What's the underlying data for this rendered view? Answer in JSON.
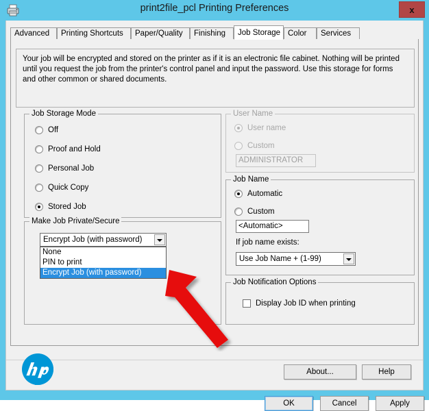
{
  "window": {
    "title": "print2file_pcl Printing Preferences",
    "icon": "printer-icon",
    "close_label": "x",
    "titlebar_color": "#5ec7e8",
    "close_color": "#b14646"
  },
  "tabs": [
    {
      "label": "Advanced",
      "selected": false
    },
    {
      "label": "Printing Shortcuts",
      "selected": false
    },
    {
      "label": "Paper/Quality",
      "selected": false
    },
    {
      "label": "Finishing",
      "selected": false
    },
    {
      "label": "Job Storage",
      "selected": true
    },
    {
      "label": "Color",
      "selected": false
    },
    {
      "label": "Services",
      "selected": false
    }
  ],
  "description": "Your job will be encrypted and stored on the printer as if it is an electronic file cabinet.  Nothing will be printed until you request the job from the printer's control panel and input the password.  Use this storage for forms and other common or shared documents.",
  "job_storage_mode": {
    "legend": "Job Storage Mode",
    "options": [
      {
        "label": "Off",
        "checked": false
      },
      {
        "label": "Proof and Hold",
        "checked": false
      },
      {
        "label": "Personal Job",
        "checked": false
      },
      {
        "label": "Quick Copy",
        "checked": false
      },
      {
        "label": "Stored Job",
        "checked": true
      }
    ]
  },
  "make_private": {
    "legend": "Make Job Private/Secure",
    "selected_value": "Encrypt Job (with password)",
    "expanded": true,
    "options": [
      {
        "label": "None",
        "selected": false
      },
      {
        "label": "PIN to print",
        "selected": false
      },
      {
        "label": "Encrypt Job (with password)",
        "selected": true
      }
    ],
    "highlight_color": "#2b8fe0"
  },
  "user_name": {
    "legend": "User Name",
    "disabled": true,
    "options": [
      {
        "label": "User name",
        "checked": true
      },
      {
        "label": "Custom",
        "checked": false
      }
    ],
    "custom_value": "ADMINISTRATOR"
  },
  "job_name": {
    "legend": "Job Name",
    "options": [
      {
        "label": "Automatic",
        "checked": true
      },
      {
        "label": "Custom",
        "checked": false
      }
    ],
    "custom_value": "<Automatic>",
    "exists_label": "If job name exists:",
    "exists_value": "Use Job Name + (1-99)"
  },
  "job_notification": {
    "legend": "Job Notification Options",
    "checkbox_label": "Display Job ID when printing",
    "checkbox_checked": false
  },
  "footer": {
    "logo": "hp-logo",
    "about_label": "About...",
    "help_label": "Help",
    "ok_label": "OK",
    "cancel_label": "Cancel",
    "apply_label": "Apply"
  },
  "annotation": {
    "arrow_color": "#e01010",
    "points_to": "Encrypt Job (with password)"
  }
}
